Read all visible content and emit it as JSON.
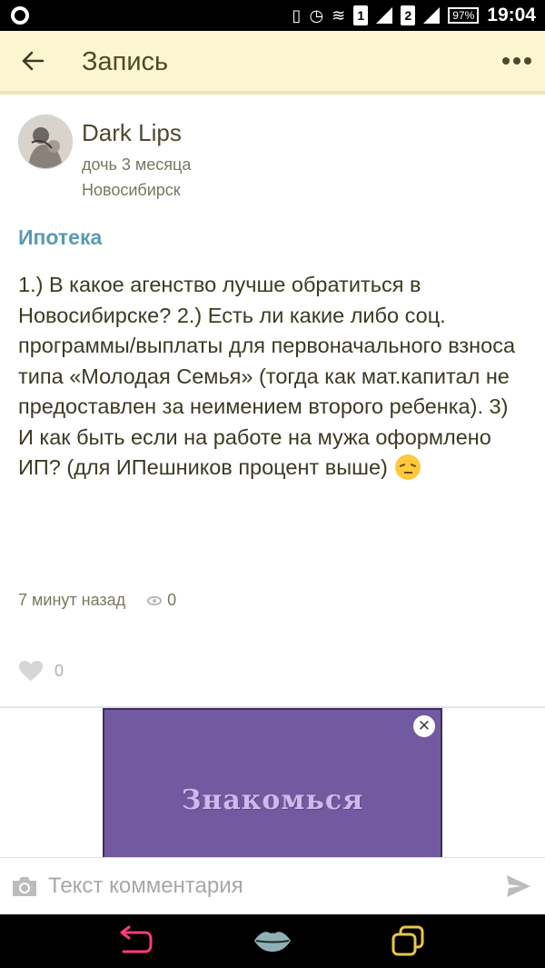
{
  "status_bar": {
    "sim1": "1",
    "sim2": "2",
    "battery": "97%",
    "time": "19:04"
  },
  "header": {
    "title": "Запись"
  },
  "author": {
    "name": "Dark Lips",
    "child": "дочь 3 месяца",
    "city": "Новосибирск"
  },
  "post": {
    "title": "Ипотека",
    "body": "1.) В какое агенство лучше обратиться в Новосибирске? 2.) Есть ли какие либо соц. программы/выплаты для первоначального взноса типа «Молодая Семья» (тогда как мат.капитал не предоставлен за неимением второго ребенка). 3) И как быть если на работе на мужа оформлено ИП? (для ИПешников процент выше)",
    "time_ago": "7 минут назад",
    "views": "0",
    "likes": "0"
  },
  "ad": {
    "text": "Знакомься",
    "background": "#725aa0"
  },
  "comment": {
    "placeholder": "Текст комментария"
  },
  "colors": {
    "header_bg": "#fbf6cf",
    "title_accent": "#5a9bb5",
    "text": "#3c3a24"
  }
}
